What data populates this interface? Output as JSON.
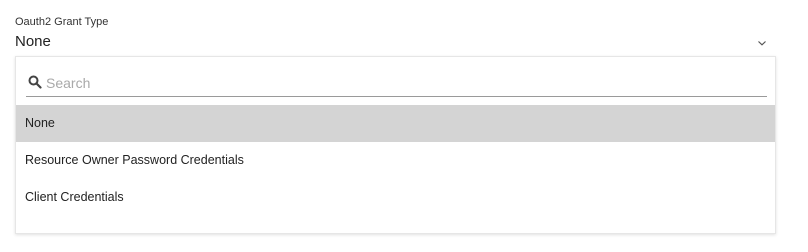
{
  "field": {
    "label": "Oauth2 Grant Type",
    "value": "None",
    "chevron_icon": "chevron-down-icon"
  },
  "dropdown": {
    "search": {
      "placeholder": "Search",
      "value": "",
      "icon": "search-icon"
    },
    "options": [
      {
        "label": "None",
        "selected": true
      },
      {
        "label": "Resource Owner Password Credentials",
        "selected": false
      },
      {
        "label": "Client Credentials",
        "selected": false
      }
    ],
    "selected_color": "#d4d4d4"
  }
}
